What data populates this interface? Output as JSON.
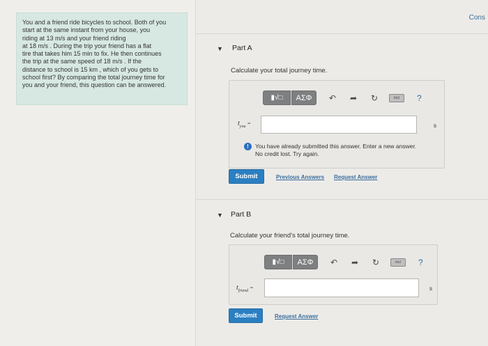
{
  "problem": {
    "text_lines": [
      "You and a friend ride bicycles to school. Both of you",
      "start at the same instant from your house, you",
      "riding at 13 m/s and your friend riding",
      "at 18 m/s . During the trip your friend has a flat",
      "tire that takes him 15 min to fix. He then continues",
      "the trip at the same speed of 18 m/s . If the",
      "distance to school is 15 km , which of you gets to",
      "school first? By comparing the total journey time for",
      "you and your friend, this question can be answered."
    ]
  },
  "header": {
    "cons_link": "Cons"
  },
  "part_a": {
    "title": "Part A",
    "question": "Calculate your total journey time.",
    "variable": "t",
    "variable_sub": "you",
    "equals": "=",
    "input_value": "",
    "unit": "s",
    "feedback": "You have already submitted this answer. Enter a new answer.",
    "feedback_line2": "No credit lost. Try again.",
    "submit_label": "Submit",
    "previous_answers_label": "Previous Answers",
    "request_answer_label": "Request Answer"
  },
  "part_b": {
    "title": "Part B",
    "question": "Calculate your friend's total journey time.",
    "variable": "t",
    "variable_sub": "friend",
    "equals": "=",
    "input_value": "",
    "unit": "s",
    "submit_label": "Submit",
    "request_answer_label": "Request Answer"
  },
  "toolbar": {
    "matrix_symbol": "▮√□",
    "greek_label": "ΑΣΦ",
    "undo_icon": "↶",
    "redo_icon": "➦",
    "reset_icon": "↻",
    "keyboard_label": "kbd",
    "help_label": "?"
  }
}
